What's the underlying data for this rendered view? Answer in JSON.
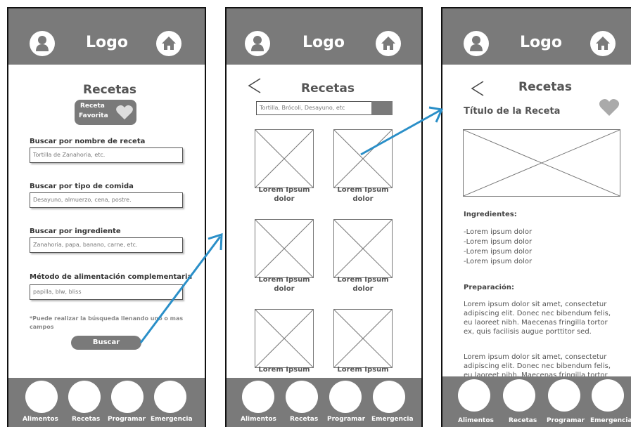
{
  "common": {
    "logo": "Logo",
    "nav": [
      "Alimentos",
      "Recetas",
      "Programar",
      "Emergencia"
    ]
  },
  "screen1": {
    "title": "Recetas",
    "favorite_line1": "Receta",
    "favorite_line2": "Favorita",
    "search_name_label": "Buscar por nombre de receta",
    "search_name_placeholder": "Tortilla de Zanahoria, etc.",
    "food_type_label": "Buscar por tipo de comida",
    "food_type_placeholder": "Desayuno, almuerzo, cena, postre.",
    "ingredient_label": "Buscar por ingrediente",
    "ingredient_placeholder": "Zanahoria, papa, banano, carne, etc.",
    "method_label": "Método de alimentación complementaria",
    "method_placeholder": "papilla, blw, bliss",
    "note": "*Puede realizar la búsqueda llenando uno o mas campos",
    "search_button": "Buscar"
  },
  "screen2": {
    "back": "<",
    "title": "Recetas",
    "search_placeholder": "Tortilla, Brócoli, Desayuno, etc",
    "card_line1": "Lorem Ipsum",
    "card_line2": "dolor"
  },
  "screen3": {
    "back": "<",
    "title": "Recetas",
    "recipe_title": "Título de la Receta",
    "ingredients_heading": "Ingredientes:",
    "ingredients": [
      "-Lorem ipsum dolor",
      "-Lorem ipsum dolor",
      "-Lorem ipsum dolor",
      "-Lorem ipsum dolor"
    ],
    "preparation_heading": "Preparación:",
    "paragraph": "Lorem ipsum dolor sit amet, consectetur adipiscing elit. Donec nec bibendum felis, eu laoreet nibh. Maecenas fringilla tortor ex, quis facilisis augue porttitor sed.",
    "paragraph2": "Lorem ipsum dolor sit amet, consectetur adipiscing elit. Donec nec bibendum felis, eu laoreet nibh. Maecenas fringilla tortor"
  },
  "colors": {
    "bar": "#7a7a7a",
    "arrow": "#2a8fc8"
  },
  "icons": [
    "user-icon",
    "home-icon",
    "heart-icon",
    "back-arrow-icon"
  ]
}
